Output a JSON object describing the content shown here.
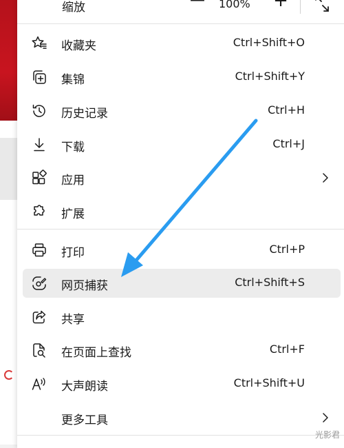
{
  "zoom": {
    "label": "缩放",
    "minus": "—",
    "value": "100%",
    "plus": "+"
  },
  "menu": {
    "items": [
      {
        "label": "收藏夹",
        "shortcut": "Ctrl+Shift+O"
      },
      {
        "label": "集锦",
        "shortcut": "Ctrl+Shift+Y"
      },
      {
        "label": "历史记录",
        "shortcut": "Ctrl+H"
      },
      {
        "label": "下载",
        "shortcut": "Ctrl+J"
      },
      {
        "label": "应用",
        "shortcut": ""
      },
      {
        "label": "扩展",
        "shortcut": ""
      },
      {
        "label": "打印",
        "shortcut": "Ctrl+P"
      },
      {
        "label": "网页捕获",
        "shortcut": "Ctrl+Shift+S"
      },
      {
        "label": "共享",
        "shortcut": ""
      },
      {
        "label": "在页面上查找",
        "shortcut": "Ctrl+F"
      },
      {
        "label": "大声朗读",
        "shortcut": "Ctrl+Shift+U"
      },
      {
        "label": "更多工具",
        "shortcut": ""
      }
    ]
  },
  "watermark": "光影君",
  "colors": {
    "arrow": "#2a9cf0",
    "highlight": "#ececec",
    "brand_red": "#c8141f"
  }
}
